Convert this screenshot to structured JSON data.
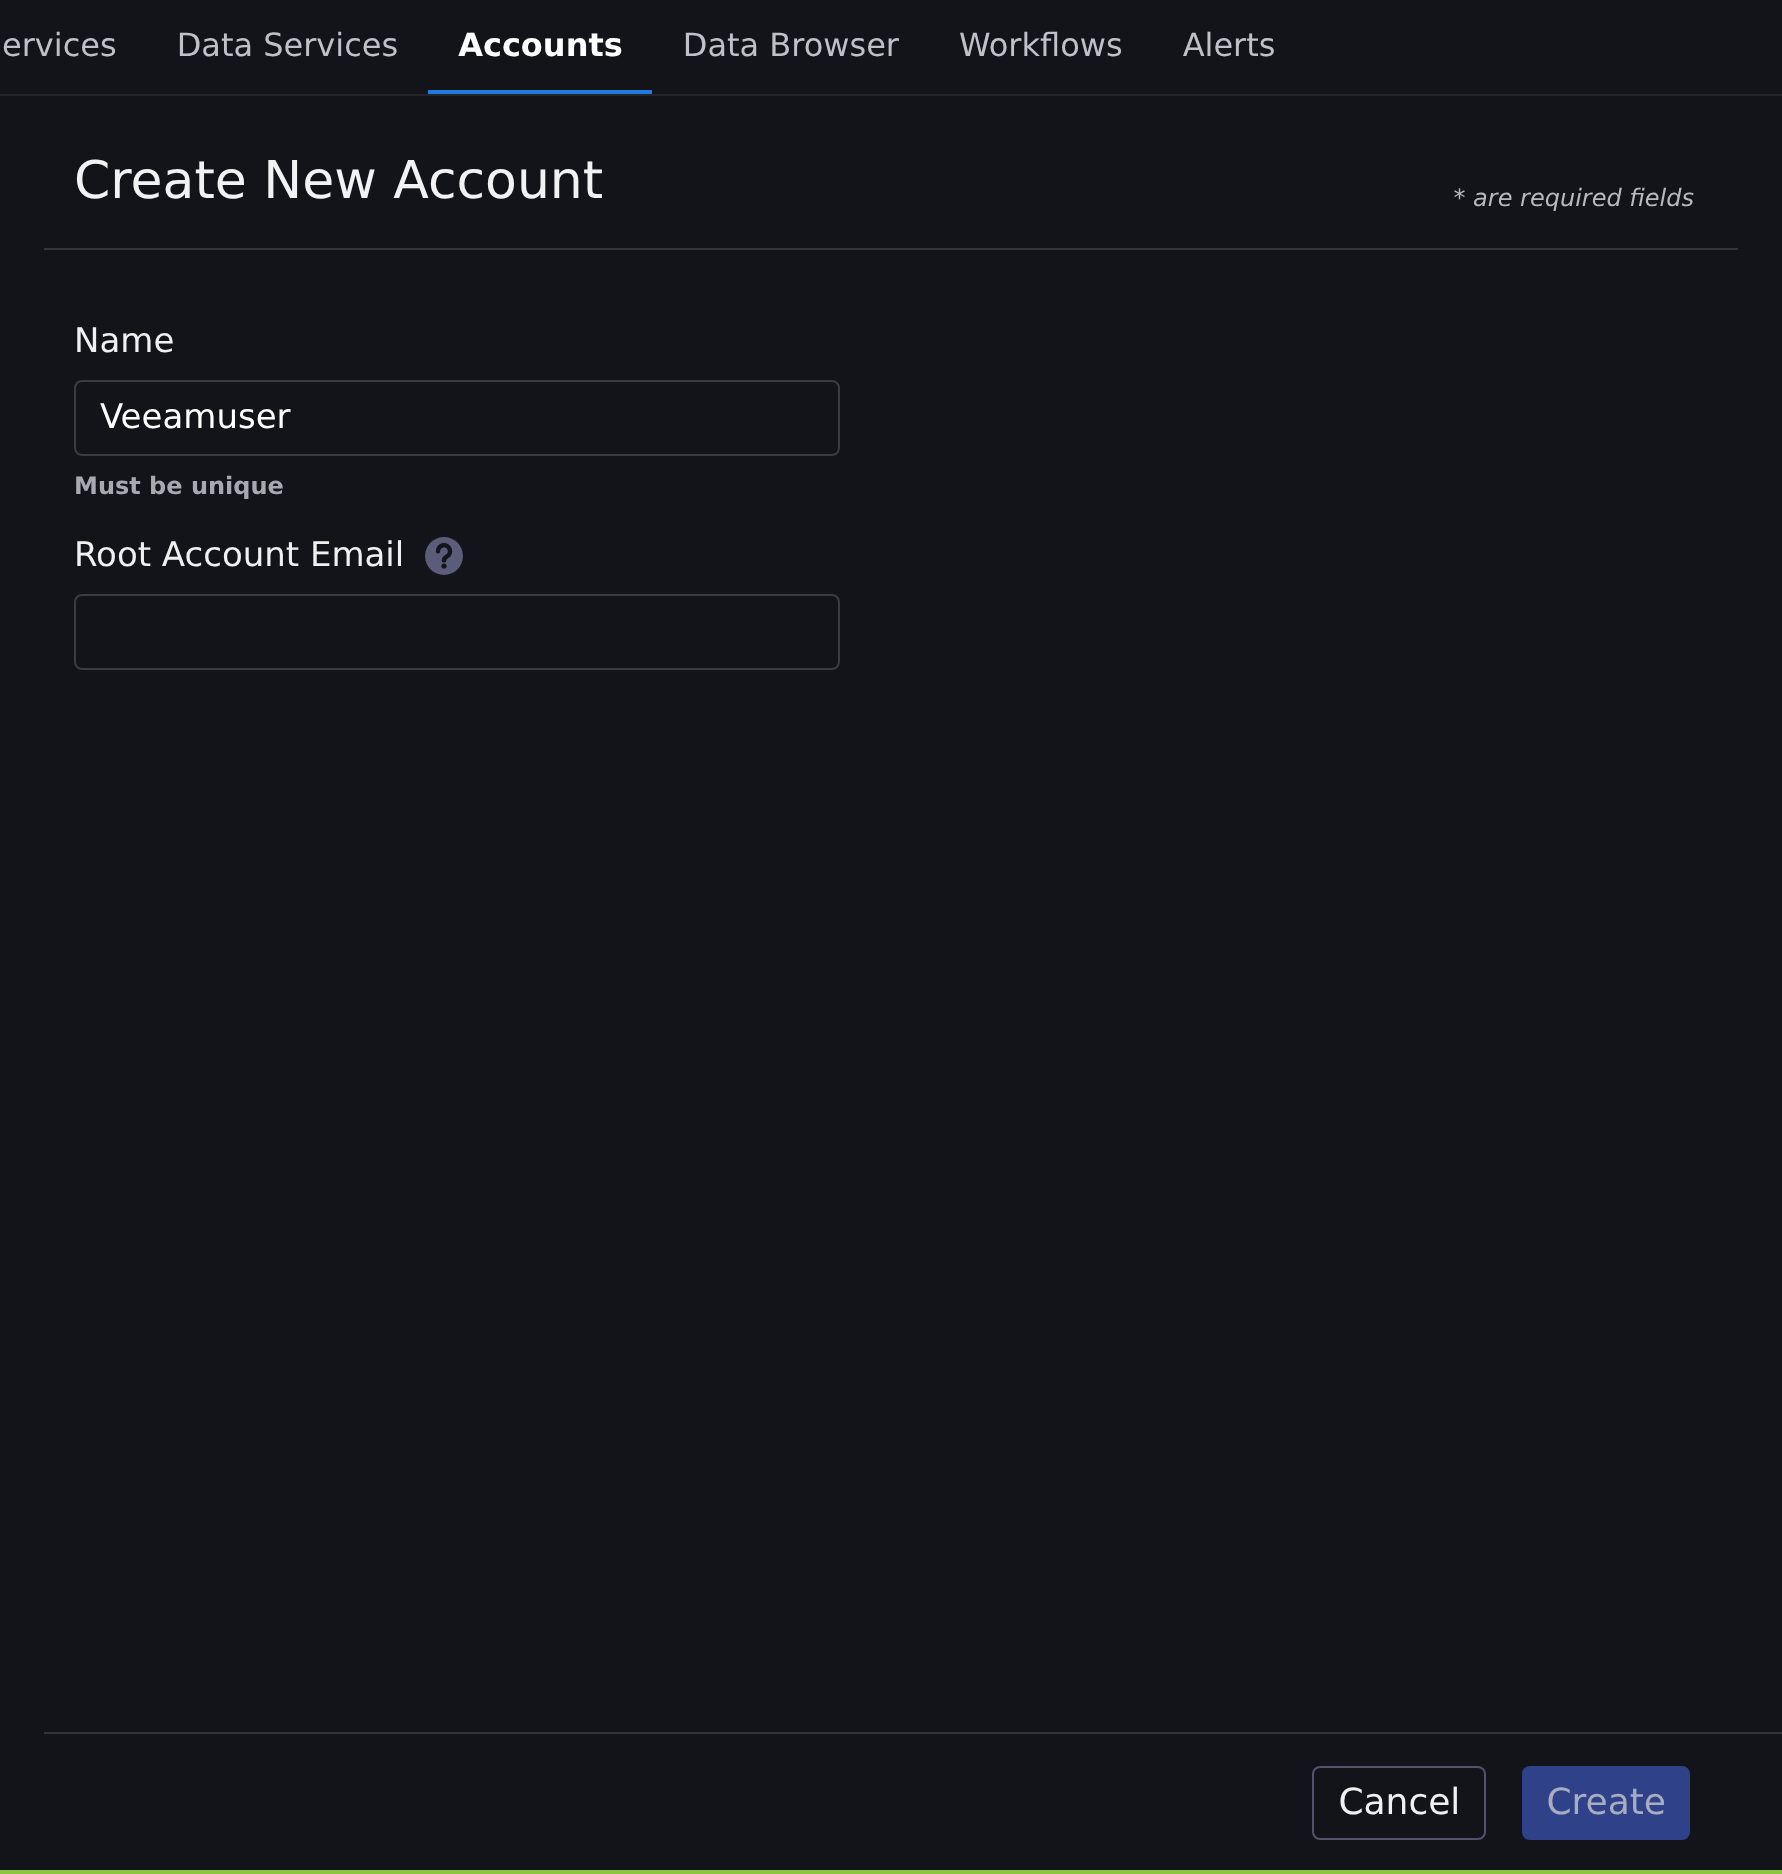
{
  "tabs": [
    {
      "label": "ervices",
      "selected": false
    },
    {
      "label": "Data Services",
      "selected": false
    },
    {
      "label": "Accounts",
      "selected": true
    },
    {
      "label": "Data Browser",
      "selected": false
    },
    {
      "label": "Workflows",
      "selected": false
    },
    {
      "label": "Alerts",
      "selected": false
    }
  ],
  "form": {
    "title": "Create New Account",
    "required_note": "* are required fields",
    "fields": [
      {
        "label": "Name",
        "value": "Veeamuser",
        "hint": "Must be unique",
        "help": false
      },
      {
        "label": "Root Account Email",
        "help": true
      }
    ]
  },
  "buttons": [
    {
      "label": "Cancel",
      "kind": "secondary",
      "disabled": false
    },
    {
      "label": "Create",
      "kind": "primary",
      "disabled": true
    }
  ]
}
